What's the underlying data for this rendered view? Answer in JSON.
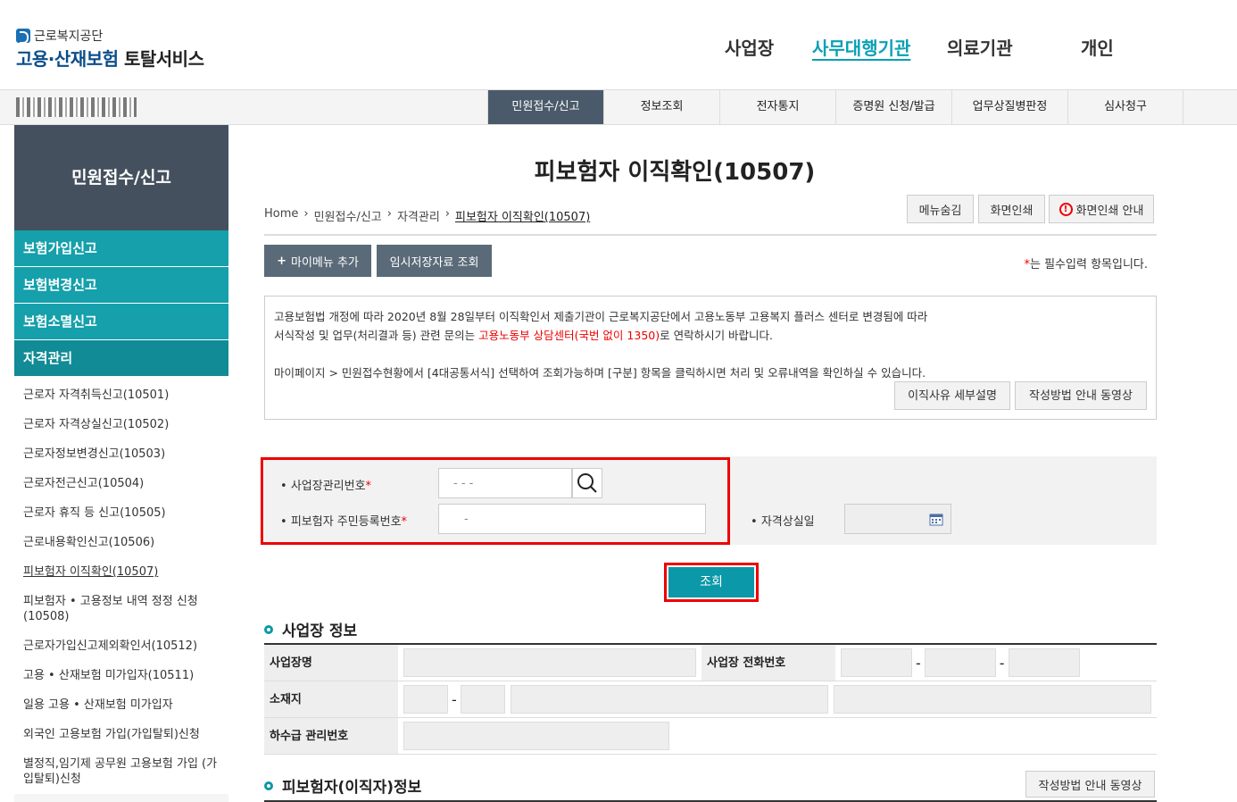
{
  "header": {
    "org_name": "근로복지공단",
    "service_name_a": "고용·산재보험",
    "service_name_b": "토탈서비스",
    "nav": [
      "사업장",
      "사무대행기관",
      "의료기관",
      "개인"
    ]
  },
  "menu": {
    "tabs": [
      "민원접수/신고",
      "정보조회",
      "전자통지",
      "증명원 신청/발급",
      "업무상질병판정",
      "심사청구"
    ]
  },
  "sidebar": {
    "title": "민원접수/신고",
    "categories": [
      "보험가입신고",
      "보험변경신고",
      "보험소멸신고",
      "자격관리"
    ],
    "items": [
      "근로자 자격취득신고(10501)",
      "근로자 자격상실신고(10502)",
      "근로자정보변경신고(10503)",
      "근로자전근신고(10504)",
      "근로자 휴직 등 신고(10505)",
      "근로내용확인신고(10506)",
      "피보험자 이직확인(10507)",
      "피보험자 • 고용정보 내역 정정 신청 (10508)",
      "근로자가입신고제외확인서(10512)",
      "고용 • 산재보험 미가입자(10511)",
      "일용 고용 • 산재보험 미가입자",
      "외국인 고용보험 가입(가입탈퇴)신청",
      "별정직,임기제 공무원 고용보험 가입 (가입탈퇴)신청"
    ]
  },
  "page": {
    "title": "피보험자 이직확인(10507)",
    "breadcrumb": [
      "Home",
      "민원접수/신고",
      "자격관리",
      "피보험자 이직확인(10507)"
    ],
    "btn_hide_menu": "메뉴숨김",
    "btn_print": "화면인쇄",
    "btn_print_guide": "화면인쇄 안내",
    "btn_add_mymenu": "마이메뉴 추가",
    "btn_temp_saved": "임시저장자료 조회",
    "required_mark": "*",
    "required_note": "는 필수입력 항목입니다.",
    "notice_line1": "고용보험법 개정에 따라 2020년 8월 28일부터 이직확인서 제출기관이 근로복지공단에서 고용노동부 고용복지 플러스 센터로 변경됨에 따라",
    "notice_line2a": "서식작성 및 업무(처리결과 등) 관련 문의는 ",
    "notice_line2_red": "고용노동부 상담센터(국번 없이 1350)",
    "notice_line2b": "로 연락하시기 바랍니다.",
    "notice_line3": "마이페이지 > 민원접수현황에서 [4대공통서식] 선택하여 조회가능하며 [구분] 항목을 클릭하시면 처리 및 오류내역을 확인하실 수 있습니다.",
    "btn_reason_detail": "이직사유 세부설명",
    "btn_howto_video": "작성방법 안내 동영상"
  },
  "search": {
    "biz_no_label": "사업장관리번호",
    "biz_no_placeholder": "- -   -",
    "resident_label": "피보험자 주민등록번호",
    "resident_placeholder": "-",
    "loss_date_label": "자격상실일",
    "submit": "조회"
  },
  "biz_info": {
    "title": "사업장 정보",
    "name_label": "사업장명",
    "phone_label": "사업장 전화번호",
    "address_label": "소재지",
    "sub_no_label": "하수급 관리번호",
    "dash": "-"
  },
  "insured_info": {
    "title": "피보험자(이직자)정보",
    "btn_video": "작성방법 안내 동영상"
  }
}
